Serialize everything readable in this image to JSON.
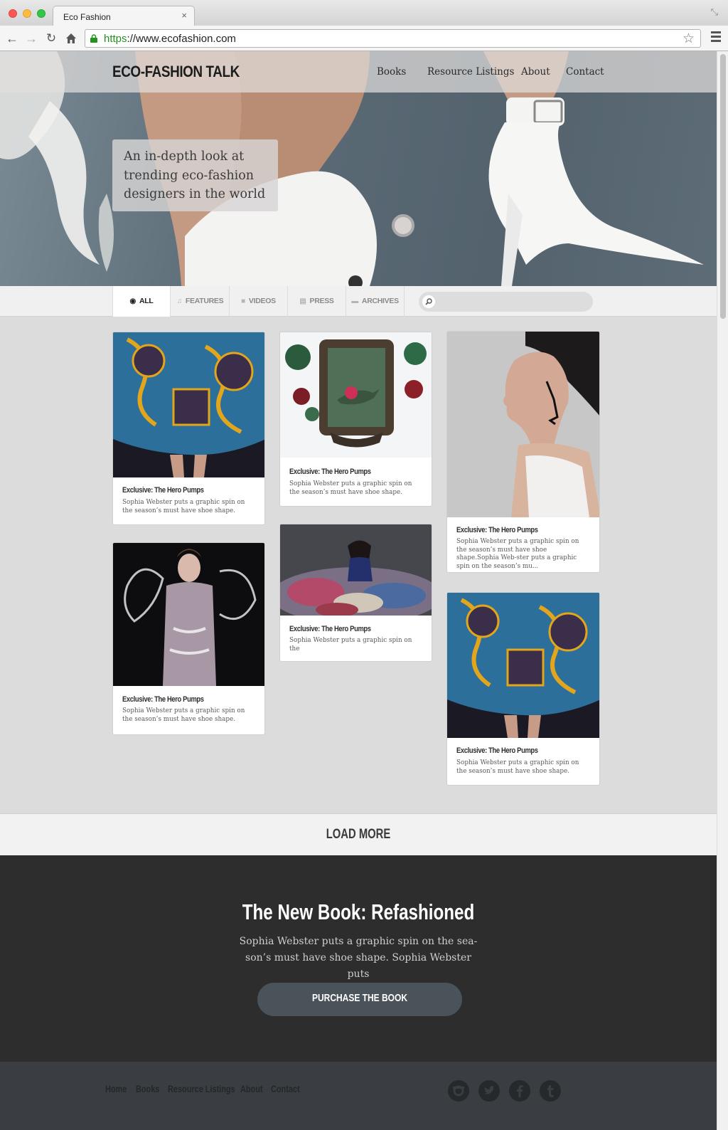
{
  "browser": {
    "tab_title": "Eco Fashion",
    "tab_close": "×",
    "url_scheme": "https",
    "url_rest": "://www.ecofashion.com"
  },
  "site": {
    "logo": "ECO-FASHION TALK",
    "nav": [
      "Books",
      "Resource Listings",
      "About",
      "Contact"
    ],
    "hero_tagline": "An in-depth look at trending eco-fashion designers in the world"
  },
  "filters": {
    "tabs": [
      {
        "label": "ALL",
        "icon": "target-icon",
        "active": true
      },
      {
        "label": "FEATURES",
        "icon": "music-note-icon",
        "active": false
      },
      {
        "label": "VIDEOS",
        "icon": "video-camera-icon",
        "active": false
      },
      {
        "label": "PRESS",
        "icon": "newspaper-icon",
        "active": false
      },
      {
        "label": "ARCHIVES",
        "icon": "chat-bubbles-icon",
        "active": false
      }
    ],
    "search_placeholder": ""
  },
  "cards": [
    {
      "title": "Exclusive: The Hero Pumps",
      "text": "Sophia Webster puts a graphic spin on the season’s must have shoe shape.",
      "image": "patterned-skirt-photo"
    },
    {
      "title": "Exclusive: The Hero Pumps",
      "text": "Sophia Webster puts a graphic spin on the season’s must have shoe shape.",
      "image": "framed-hummingbird-photo"
    },
    {
      "title": "Exclusive: The Hero Pumps",
      "text": "Sophia Webster puts a graphic spin on the season’s must have shoe shape.Sophia Web-ster puts a graphic spin on the season’s mu...",
      "image": "profile-portrait-photo"
    },
    {
      "title": "Exclusive: The Hero Pumps",
      "text": "Sophia Webster puts a graphic spin on the season’s must have shoe shape.",
      "image": "liquid-dress-photo"
    },
    {
      "title": "Exclusive: The Hero Pumps",
      "text": "Sophia Webster puts a graphic spin on the",
      "image": "clothes-pile-photo"
    },
    {
      "title": "Exclusive: The Hero Pumps",
      "text": "Sophia Webster puts a graphic spin on the season’s must have shoe shape.",
      "image": "patterned-skirt-photo"
    }
  ],
  "load_more": "LOAD MORE",
  "book": {
    "title": "The New Book: Refashioned",
    "text": "Sophia Webster puts a graphic spin on the sea-son’s must have shoe shape. Sophia Webster puts",
    "button": "PURCHASE THE BOOK"
  },
  "footer": {
    "nav": [
      "Home",
      "Books",
      "Resource Listings",
      "About",
      "Contact"
    ],
    "social": [
      "instagram-icon",
      "twitter-icon",
      "facebook-icon",
      "tumblr-icon"
    ]
  },
  "colors": {
    "accent_green": "#23921f",
    "dark_section": "#2d2d2d",
    "button": "#4a525a",
    "footer": "#3a3d41"
  }
}
